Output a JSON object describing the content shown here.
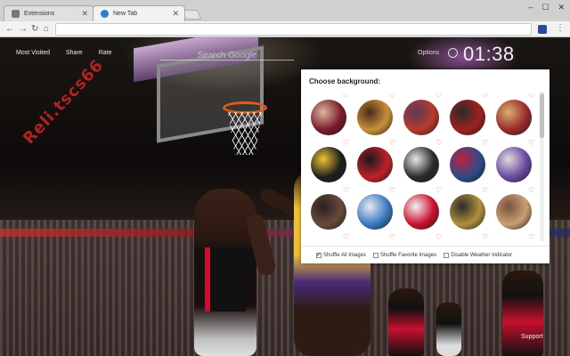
{
  "browser": {
    "tabs": [
      {
        "label": "Extensions",
        "active": false
      },
      {
        "label": "New Tab",
        "active": true
      }
    ],
    "omnibox": {
      "value": ""
    }
  },
  "topnav": {
    "most_visited": "Most Visited",
    "share": "Share",
    "rate": "Rate"
  },
  "search": {
    "placeholder": "Search Google"
  },
  "options_label": "Options",
  "clock": "01:38",
  "watermark": "Reli.tscs66",
  "panel": {
    "title": "Choose background:",
    "thumbnails": [
      {
        "name": "thumb-1",
        "colors": [
          "#7a1a2a",
          "#d8b89a"
        ]
      },
      {
        "name": "thumb-2",
        "colors": [
          "#c9903a",
          "#4a2a1a"
        ]
      },
      {
        "name": "thumb-3",
        "colors": [
          "#b73a2a",
          "#5a3a5a"
        ]
      },
      {
        "name": "thumb-4",
        "colors": [
          "#a02020",
          "#2a2a2a"
        ]
      },
      {
        "name": "thumb-5",
        "colors": [
          "#9a2a2a",
          "#d8b070"
        ]
      },
      {
        "name": "thumb-6",
        "colors": [
          "#1e1e1e",
          "#f0c233"
        ]
      },
      {
        "name": "thumb-7",
        "colors": [
          "#c0202a",
          "#1a1a1a"
        ]
      },
      {
        "name": "thumb-8",
        "colors": [
          "#2a2a2a",
          "#e8e8e8"
        ]
      },
      {
        "name": "thumb-9",
        "colors": [
          "#2c4d8a",
          "#c0203a"
        ]
      },
      {
        "name": "thumb-10",
        "colors": [
          "#6a4aa0",
          "#dcdcdc"
        ]
      },
      {
        "name": "thumb-11",
        "colors": [
          "#6a4a3a",
          "#2a2020"
        ]
      },
      {
        "name": "thumb-12",
        "colors": [
          "#3a79c0",
          "#e8e8f0"
        ]
      },
      {
        "name": "thumb-13",
        "colors": [
          "#c8102e",
          "#f2f2f2"
        ]
      },
      {
        "name": "thumb-14",
        "colors": [
          "#b0903a",
          "#2a2a2a"
        ]
      },
      {
        "name": "thumb-15",
        "colors": [
          "#c8a070",
          "#7a5040"
        ]
      },
      {
        "name": "thumb-16",
        "colors": [
          "#3a3a6a",
          "#a0a0c0"
        ]
      },
      {
        "name": "thumb-17",
        "colors": [
          "#2a4a8a",
          "#c0c0d0"
        ]
      },
      {
        "name": "thumb-18",
        "colors": [
          "#c0203a",
          "#2a2a2a"
        ]
      },
      {
        "name": "thumb-19",
        "colors": [
          "#d0d0d0",
          "#8a8a8a"
        ]
      },
      {
        "name": "thumb-20",
        "colors": [
          "#a02a2a",
          "#e8e8e8"
        ]
      }
    ],
    "options": [
      {
        "label": "Shuffle All Images",
        "checked": true
      },
      {
        "label": "Shuffle Favorite Images",
        "checked": false
      },
      {
        "label": "Disable Weather Indicator",
        "checked": false
      }
    ]
  },
  "support_label": "Support"
}
